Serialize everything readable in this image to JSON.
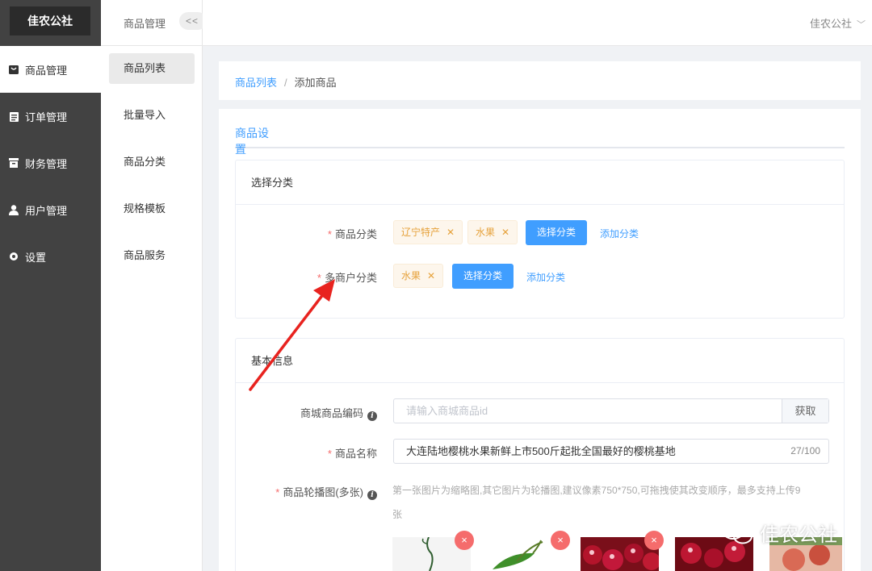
{
  "app": {
    "logo": "佳农公社"
  },
  "sidebar": {
    "items": [
      {
        "label": "商品管理",
        "icon": "bag-icon",
        "active": true
      },
      {
        "label": "订单管理",
        "icon": "clipboard-icon",
        "active": false
      },
      {
        "label": "财务管理",
        "icon": "finance-icon",
        "active": false
      },
      {
        "label": "用户管理",
        "icon": "user-icon",
        "active": false
      },
      {
        "label": "设置",
        "icon": "gear-icon",
        "active": false
      }
    ]
  },
  "subnav": {
    "title": "商品管理",
    "collapse_label": "<<",
    "items": [
      {
        "label": "商品列表",
        "active": true
      },
      {
        "label": "批量导入",
        "active": false
      },
      {
        "label": "商品分类",
        "active": false
      },
      {
        "label": "规格模板",
        "active": false
      },
      {
        "label": "商品服务",
        "active": false
      }
    ]
  },
  "header": {
    "user": "佳农公社",
    "chevron": "﹀"
  },
  "breadcrumb": {
    "parent": "商品列表",
    "separator": "/",
    "current": "添加商品"
  },
  "tabs": [
    {
      "label": "商品设置",
      "active": true
    }
  ],
  "category_section": {
    "title": "选择分类",
    "product_category": {
      "label": "商品分类",
      "tags": [
        "辽宁特产",
        "水果"
      ],
      "select_button": "选择分类",
      "add_link": "添加分类"
    },
    "merchant_category": {
      "label": "多商户分类",
      "tags": [
        "水果"
      ],
      "select_button": "选择分类",
      "add_link": "添加分类"
    }
  },
  "basic_section": {
    "title": "基本信息",
    "mall_code": {
      "label": "商城商品编码",
      "placeholder": "请输入商城商品id",
      "button": "获取"
    },
    "product_name": {
      "label": "商品名称",
      "value": "大连陆地樱桃水果新鲜上市500斤起批全国最好的樱桃基地",
      "count": "27/100"
    },
    "carousel": {
      "label": "商品轮播图(多张)",
      "hint_line1": "第一张图片为缩略图,其它图片为轮播图,建议像素750*750,可拖拽使其改变顺序，最多支持上传9",
      "hint_line2": "张",
      "delete_glyph": "×"
    }
  },
  "watermark": "佳农公社",
  "colors": {
    "primary": "#409eff",
    "sidebar": "#424242",
    "tag_text": "#e6a23c",
    "required": "#f56c6c",
    "arrow": "#e8231f"
  }
}
